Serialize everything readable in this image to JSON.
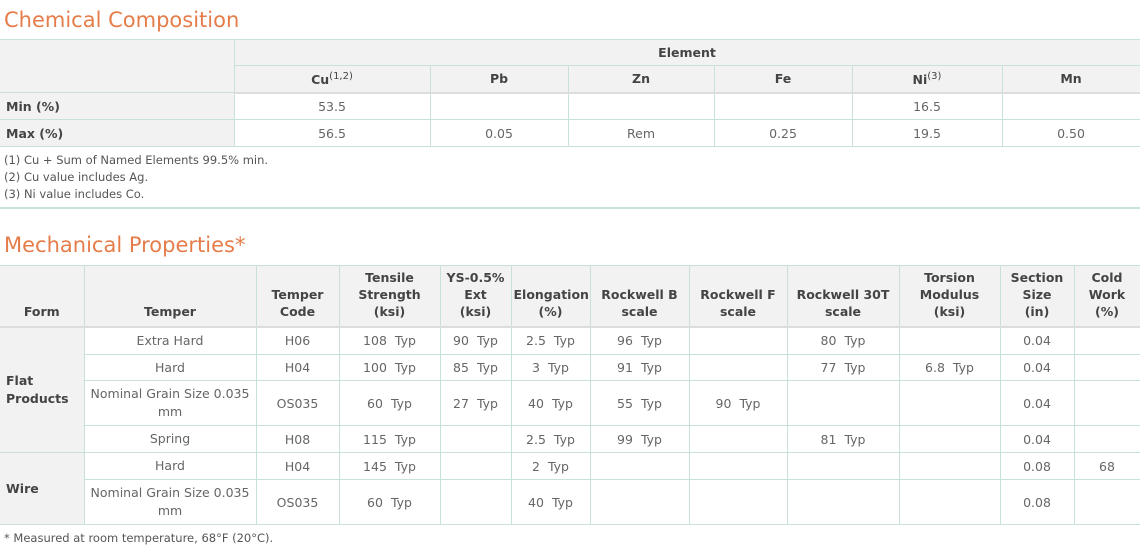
{
  "chemical": {
    "title": "Chemical Composition",
    "group_header": "Element",
    "columns": [
      {
        "label": "Cu",
        "sup": "(1,2)"
      },
      {
        "label": "Pb",
        "sup": ""
      },
      {
        "label": "Zn",
        "sup": ""
      },
      {
        "label": "Fe",
        "sup": ""
      },
      {
        "label": "Ni",
        "sup": "(3)"
      },
      {
        "label": "Mn",
        "sup": ""
      }
    ],
    "rows": [
      {
        "label": "Min (%)",
        "values": [
          "53.5",
          "",
          "",
          "",
          "16.5",
          ""
        ]
      },
      {
        "label": "Max (%)",
        "values": [
          "56.5",
          "0.05",
          "Rem",
          "0.25",
          "19.5",
          "0.50"
        ]
      }
    ],
    "notes": [
      "(1) Cu + Sum of Named Elements 99.5% min.",
      "(2) Cu value includes Ag.",
      "(3) Ni value includes Co."
    ]
  },
  "mechanical": {
    "title": "Mechanical Properties*",
    "headers": [
      [
        "Form"
      ],
      [
        "Temper"
      ],
      [
        "Temper",
        "Code"
      ],
      [
        "Tensile",
        "Strength",
        "(ksi)"
      ],
      [
        "YS-0.5%",
        "Ext",
        "(ksi)"
      ],
      [
        "Elongation",
        "(%)"
      ],
      [
        "Rockwell B",
        "scale"
      ],
      [
        "Rockwell F",
        "scale"
      ],
      [
        "Rockwell 30T",
        "scale"
      ],
      [
        "Torsion",
        "Modulus",
        "(ksi)"
      ],
      [
        "Section",
        "Size",
        "(in)"
      ],
      [
        "Cold",
        "Work",
        "(%)"
      ]
    ],
    "typ_label": "Typ",
    "forms": [
      {
        "name": "Flat Products",
        "rows": [
          {
            "temper": "Extra Hard",
            "code": "H06",
            "tensile": "108",
            "ys": "90",
            "elong": "2.5",
            "rb": "96",
            "rf": "",
            "r30t": "80",
            "torsion": "",
            "section": "0.04",
            "cold": ""
          },
          {
            "temper": "Hard",
            "code": "H04",
            "tensile": "100",
            "ys": "85",
            "elong": "3",
            "rb": "91",
            "rf": "",
            "r30t": "77",
            "torsion": "6.8",
            "section": "0.04",
            "cold": ""
          },
          {
            "temper": "Nominal Grain Size 0.035 mm",
            "code": "OS035",
            "tensile": "60",
            "ys": "27",
            "elong": "40",
            "rb": "55",
            "rf": "90",
            "r30t": "",
            "torsion": "",
            "section": "0.04",
            "cold": ""
          },
          {
            "temper": "Spring",
            "code": "H08",
            "tensile": "115",
            "ys": "",
            "elong": "2.5",
            "rb": "99",
            "rf": "",
            "r30t": "81",
            "torsion": "",
            "section": "0.04",
            "cold": ""
          }
        ]
      },
      {
        "name": "Wire",
        "rows": [
          {
            "temper": "Hard",
            "code": "H04",
            "tensile": "145",
            "ys": "",
            "elong": "2",
            "rb": "",
            "rf": "",
            "r30t": "",
            "torsion": "",
            "section": "0.08",
            "cold": "68"
          },
          {
            "temper": "Nominal Grain Size 0.035 mm",
            "code": "OS035",
            "tensile": "60",
            "ys": "",
            "elong": "40",
            "rb": "",
            "rf": "",
            "r30t": "",
            "torsion": "",
            "section": "0.08",
            "cold": ""
          }
        ]
      }
    ],
    "footnote": "* Measured at room temperature, 68°F (20°C)."
  },
  "colors": {
    "title_accent": "#e57d4a",
    "header_bg": "#f2f2f2",
    "border": "#c9e2d9"
  }
}
